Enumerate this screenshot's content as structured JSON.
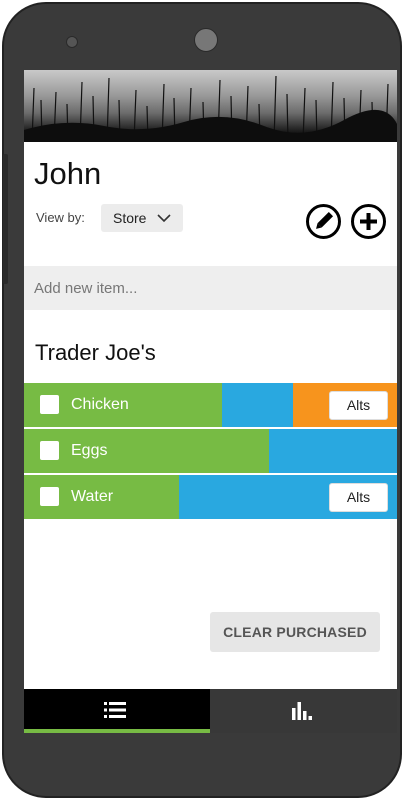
{
  "list": {
    "owner": "John"
  },
  "view_by": {
    "label": "View by:",
    "selected": "Store"
  },
  "add_item": {
    "placeholder": "Add new item..."
  },
  "store": {
    "name": "Trader Joe's",
    "items": [
      {
        "name": "Chicken",
        "alts_label": "Alts"
      },
      {
        "name": "Eggs"
      },
      {
        "name": "Water",
        "alts_label": "Alts"
      }
    ]
  },
  "actions": {
    "clear_purchased": "CLEAR PURCHASED"
  },
  "nav": {
    "tabs": [
      {
        "icon": "list-icon",
        "active": true
      },
      {
        "icon": "bar-chart-icon",
        "active": false
      }
    ]
  },
  "colors": {
    "green": "#77bb44",
    "blue": "#29a8e0",
    "orange": "#f7941d",
    "nav_active": "#000000",
    "nav_inactive": "#383838"
  },
  "icons": {
    "edit": "pencil-icon",
    "add": "plus-icon",
    "dropdown": "chevron-down-icon"
  }
}
